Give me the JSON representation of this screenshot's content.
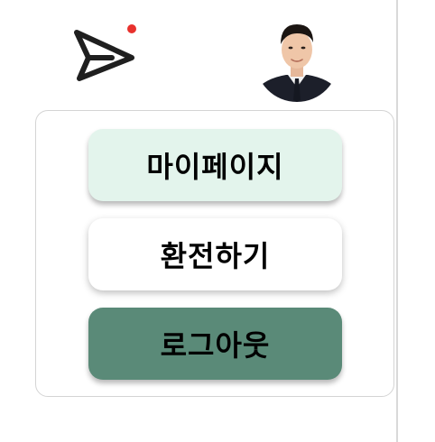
{
  "header": {
    "logo_icon": "paper-plane-icon",
    "notification_dot_color": "#e8312d",
    "avatar_icon": "profile-photo"
  },
  "menu": {
    "items": [
      {
        "label": "마이페이지",
        "background": "#e3f4ec"
      },
      {
        "label": "환전하기",
        "background": "#ffffff"
      },
      {
        "label": "로그아웃",
        "background": "#5a8a78"
      }
    ]
  }
}
